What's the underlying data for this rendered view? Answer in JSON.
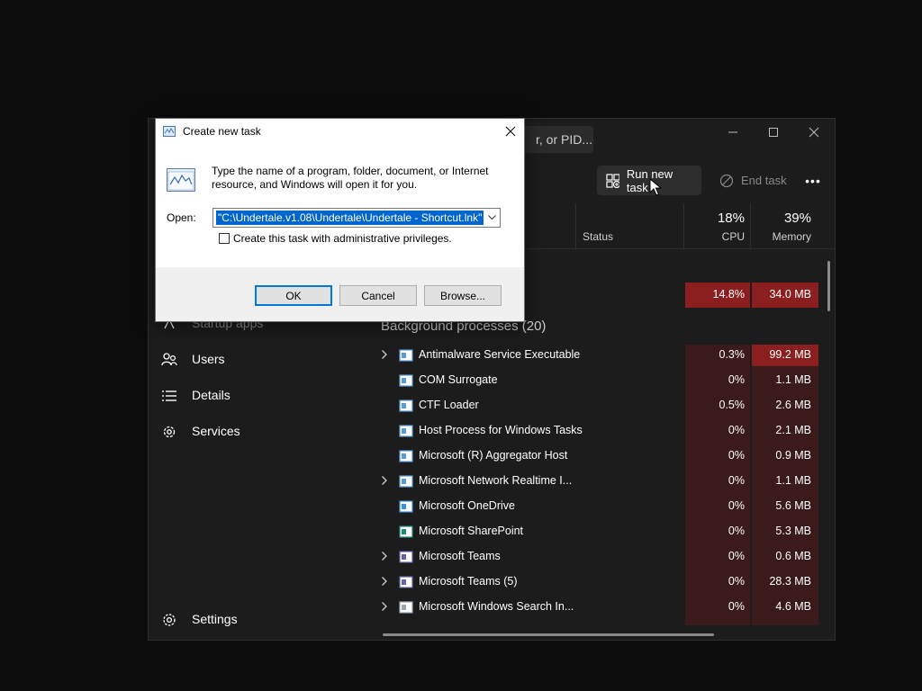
{
  "taskmanager": {
    "search_placeholder": "r, or PID...",
    "toolbar": {
      "run_new_task": "Run new task",
      "end_task": "End task",
      "more": "•••"
    },
    "columns": {
      "status": "Status",
      "cpu_pct": "18%",
      "cpu": "CPU",
      "mem_pct": "39%",
      "memory": "Memory"
    },
    "top_row": {
      "cpu": "14.8%",
      "memory": "34.0 MB"
    },
    "section_title": "Background processes (20)",
    "processes": [
      {
        "name": "Antimalware Service Executable",
        "cpu": "0.3%",
        "memory": "99.2 MB",
        "expandable": true
      },
      {
        "name": "COM Surrogate",
        "cpu": "0%",
        "memory": "1.1 MB",
        "expandable": false
      },
      {
        "name": "CTF Loader",
        "cpu": "0.5%",
        "memory": "2.6 MB",
        "expandable": false
      },
      {
        "name": "Host Process for Windows Tasks",
        "cpu": "0%",
        "memory": "2.1 MB",
        "expandable": false
      },
      {
        "name": "Microsoft (R) Aggregator Host",
        "cpu": "0%",
        "memory": "0.9 MB",
        "expandable": false
      },
      {
        "name": "Microsoft Network Realtime I...",
        "cpu": "0%",
        "memory": "1.1 MB",
        "expandable": true
      },
      {
        "name": "Microsoft OneDrive",
        "cpu": "0%",
        "memory": "5.6 MB",
        "expandable": false
      },
      {
        "name": "Microsoft SharePoint",
        "cpu": "0%",
        "memory": "5.3 MB",
        "expandable": false
      },
      {
        "name": "Microsoft Teams",
        "cpu": "0%",
        "memory": "0.6 MB",
        "expandable": true
      },
      {
        "name": "Microsoft Teams (5)",
        "cpu": "0%",
        "memory": "28.3 MB",
        "expandable": true
      },
      {
        "name": "Microsoft Windows Search In...",
        "cpu": "0%",
        "memory": "4.6 MB",
        "expandable": true
      }
    ],
    "sidebar": {
      "startup_apps": "Startup apps",
      "users": "Users",
      "details": "Details",
      "services": "Services",
      "settings": "Settings"
    }
  },
  "dialog": {
    "title": "Create new task",
    "description": "Type the name of a program, folder, document, or Internet resource, and Windows will open it for you.",
    "open_label": "Open:",
    "open_value": "\"C:\\Undertale.v1.08\\Undertale\\Undertale - Shortcut.lnk\"",
    "admin_checkbox_label": "Create this task with administrative privileges.",
    "ok": "OK",
    "cancel": "Cancel",
    "browse": "Browse..."
  },
  "colors": {
    "accent": "#0078d7",
    "selection": "#0066cc",
    "heat_high": "#8b1f1f",
    "heat_low": "#3a1a1a"
  }
}
